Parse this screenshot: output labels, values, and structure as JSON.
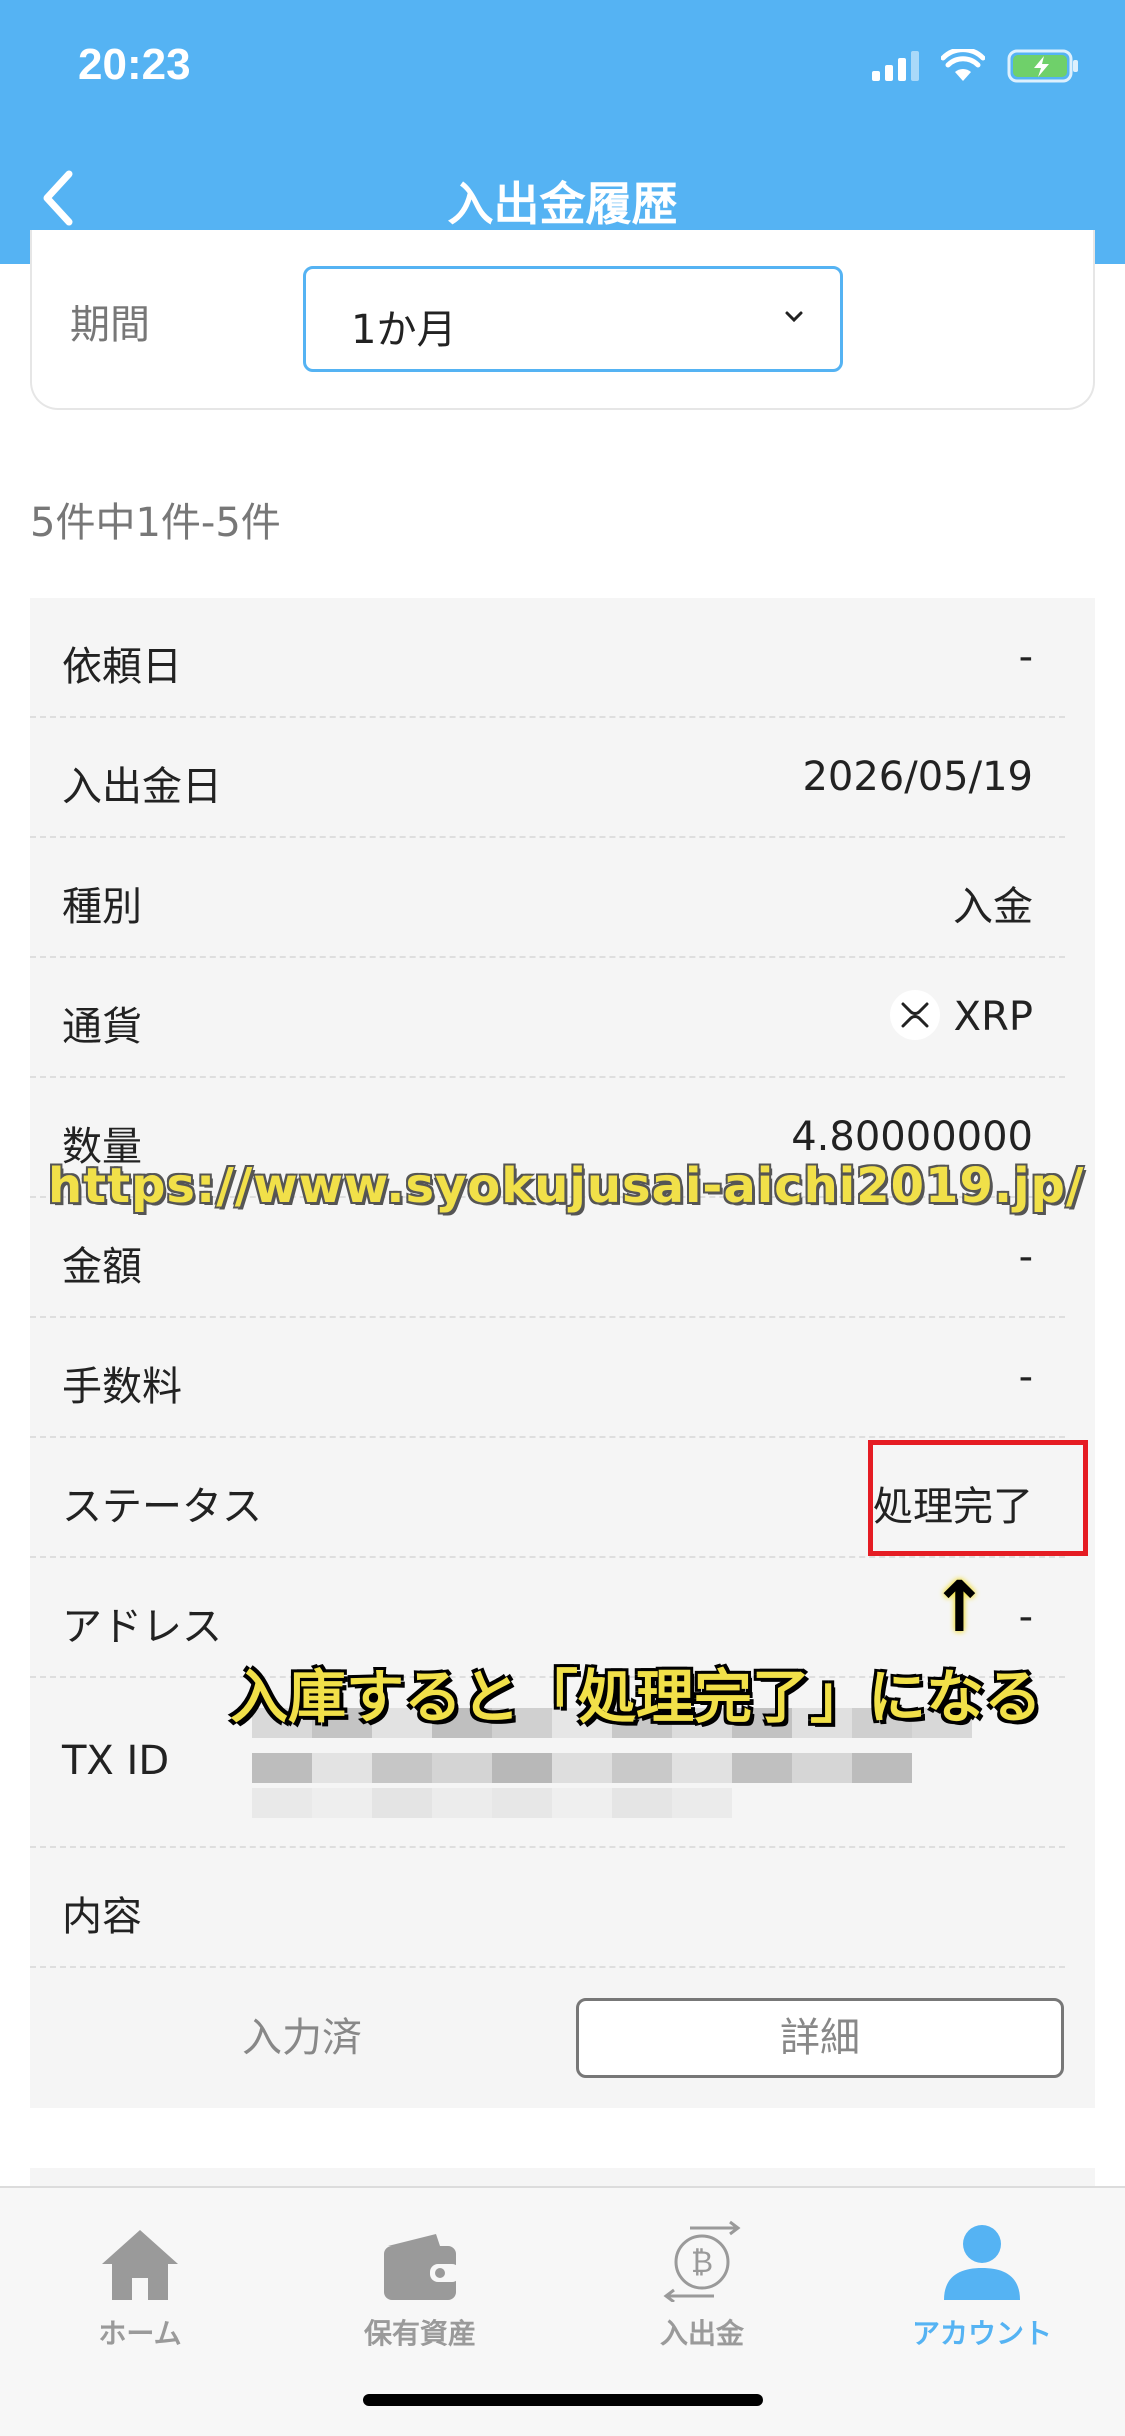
{
  "status_bar": {
    "time": "20:23"
  },
  "header": {
    "title": "入出金履歴"
  },
  "filter": {
    "period_label": "期間",
    "period_value": "1か月"
  },
  "result_count": "5件中1件-5件",
  "record": {
    "rows": [
      {
        "label": "依頼日",
        "value": "-"
      },
      {
        "label": "入出金日",
        "value": "2026/05/19"
      },
      {
        "label": "種別",
        "value": "入金"
      },
      {
        "label": "通貨",
        "value": "XRP"
      },
      {
        "label": "数量",
        "value": "4.80000000"
      },
      {
        "label": "金額",
        "value": "-"
      },
      {
        "label": "手数料",
        "value": "-"
      },
      {
        "label": "ステータス",
        "value": "処理完了"
      },
      {
        "label": "アドレス",
        "value": "-"
      },
      {
        "label": "TX ID",
        "value": ""
      },
      {
        "label": "内容",
        "value": ""
      }
    ],
    "input_done": "入力済",
    "detail_button": "詳細"
  },
  "overlay": {
    "watermark": "https://www.syokujusai-aichi2019.jp/",
    "arrow": "↑",
    "note": "入庫すると「処理完了」になる"
  },
  "tabbar": {
    "tabs": [
      {
        "label": "ホーム",
        "icon": "home-icon"
      },
      {
        "label": "保有資産",
        "icon": "wallet-icon"
      },
      {
        "label": "入出金",
        "icon": "bitcoin-transfer-icon"
      },
      {
        "label": "アカウント",
        "icon": "account-icon"
      }
    ],
    "active_index": 3
  },
  "colors": {
    "accent": "#55b3f3",
    "highlight": "#e51c23",
    "annotation": "#f1e049"
  }
}
